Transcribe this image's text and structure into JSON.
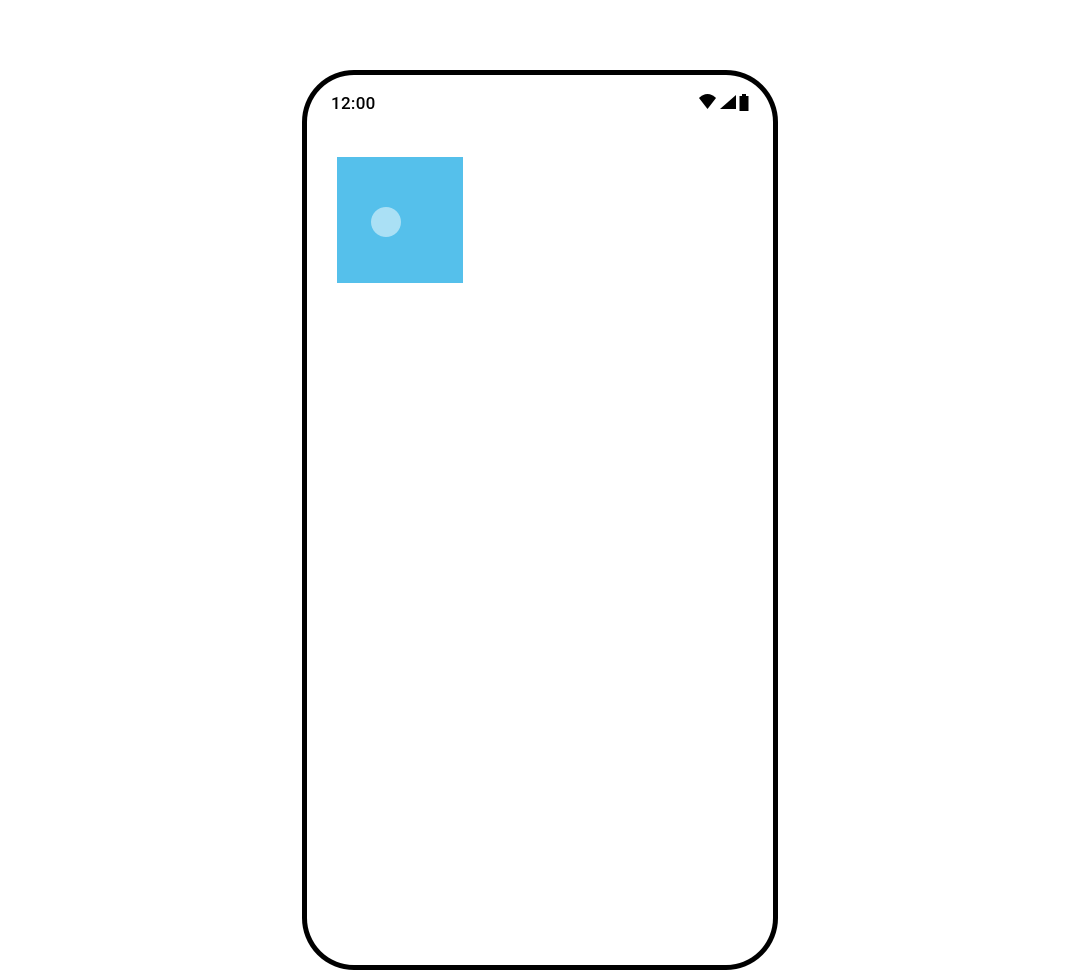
{
  "status_bar": {
    "time": "12:00"
  },
  "colors": {
    "square": "#55c0eb",
    "ripple": "rgba(255,255,255,0.5)",
    "frame": "#000000"
  }
}
